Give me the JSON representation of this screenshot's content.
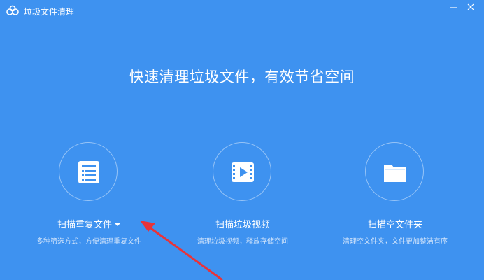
{
  "window": {
    "title": "垃圾文件清理",
    "background": "#3e92f0"
  },
  "headline": "快速清理垃圾文件，有效节省空间",
  "features": [
    {
      "label": "扫描重复文件",
      "has_dropdown": true,
      "description": "多种筛选方式，方便清理重复文件",
      "icon": "document-list-icon"
    },
    {
      "label": "扫描垃圾视频",
      "has_dropdown": false,
      "description": "清理垃圾视频，释放存储空间",
      "icon": "video-film-icon"
    },
    {
      "label": "扫描空文件夹",
      "has_dropdown": false,
      "description": "清理空文件夹，文件更加整洁有序",
      "icon": "folder-icon"
    }
  ],
  "annotation": {
    "type": "red-arrow",
    "color": "#e8333a"
  }
}
